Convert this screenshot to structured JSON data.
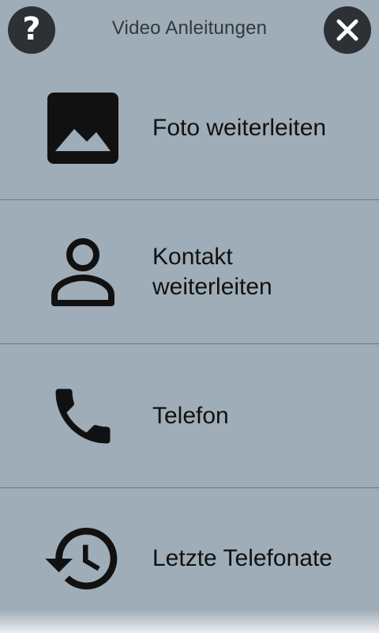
{
  "header": {
    "title": "Video Anleitungen",
    "help_icon": "question-mark-icon",
    "close_icon": "close-icon"
  },
  "items": [
    {
      "label": "Foto weiterleiten",
      "icon": "photo-icon"
    },
    {
      "label": "Kontakt\nweiterleiten",
      "icon": "person-icon"
    },
    {
      "label": "Telefon",
      "icon": "phone-icon"
    },
    {
      "label": "Letzte Telefonate",
      "icon": "history-icon"
    }
  ],
  "colors": {
    "background": "#9eadb8",
    "divider": "#6c767d",
    "button_bg": "#2d3034",
    "text": "#111111"
  }
}
